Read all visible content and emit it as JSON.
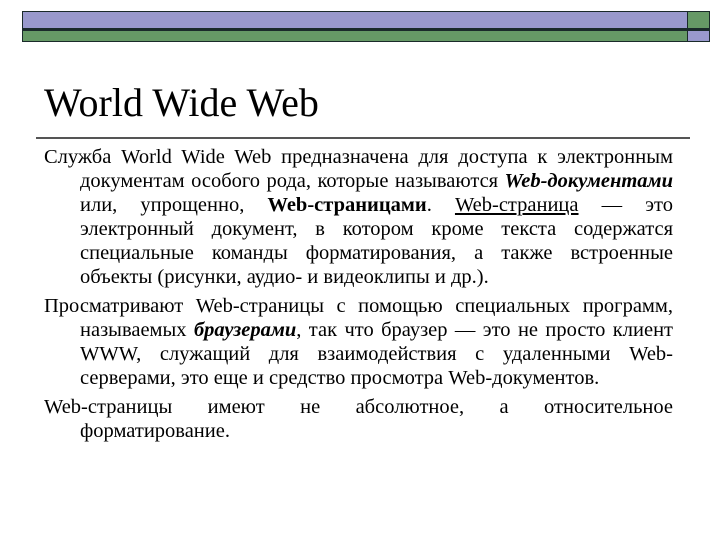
{
  "decor": {
    "colors": {
      "lavender": "#9999cc",
      "green": "#669966",
      "rule": "#555555"
    }
  },
  "slide": {
    "title": "World Wide Web",
    "paragraphs": [
      {
        "runs": [
          {
            "text": "Служба World Wide Web предназначена для доступа к электронным документам особого рода, которые называются ",
            "style": "normal"
          },
          {
            "text": "Web-документами",
            "style": "bold-italic"
          },
          {
            "text": " или, упрощенно, ",
            "style": "normal"
          },
          {
            "text": "Web-страницами",
            "style": "bold"
          },
          {
            "text": ". ",
            "style": "normal"
          },
          {
            "text": "Web-страница",
            "style": "underline"
          },
          {
            "text": " — это электронный документ, в котором кроме текста содержатся специальные команды форматирования, а также встроенные объекты (рисунки, аудио- и видеоклипы и др.).",
            "style": "normal"
          }
        ]
      },
      {
        "runs": [
          {
            "text": "Просматривают Web-страницы с помощью специальных программ, называемых ",
            "style": "normal"
          },
          {
            "text": "браузерами",
            "style": "bold-italic"
          },
          {
            "text": ", так что браузер — это не просто клиент WWW, служащий для взаимодействия с удаленными Web-серверами, это еще и средство просмотра Web-документов.",
            "style": "normal"
          }
        ]
      },
      {
        "runs": [
          {
            "text": "Web-страницы имеют не абсолютное, а относительное форматирование.",
            "style": "normal"
          }
        ]
      }
    ]
  }
}
